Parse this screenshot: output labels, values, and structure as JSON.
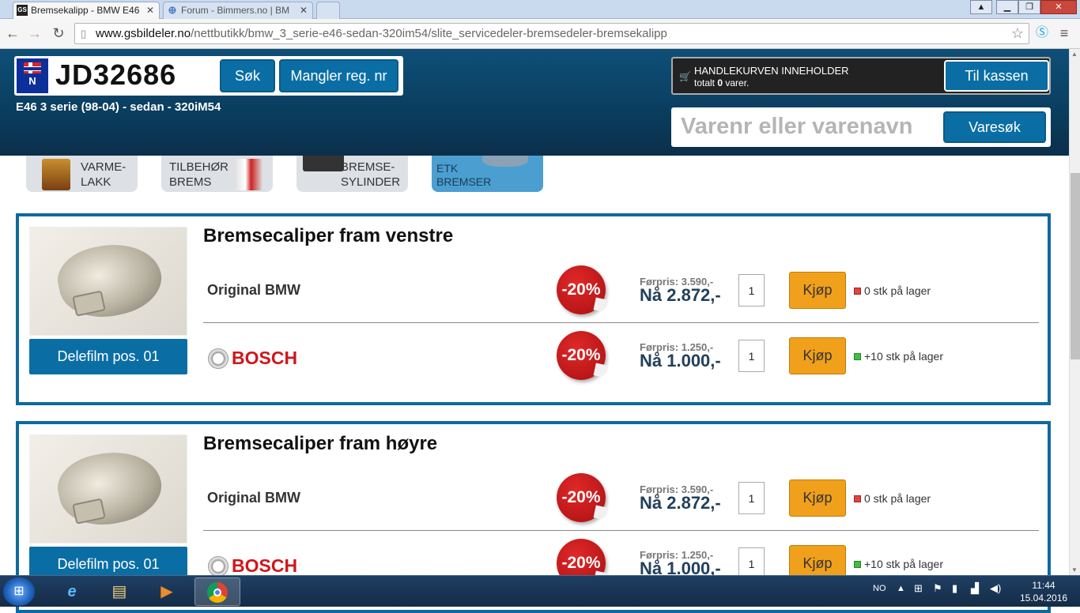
{
  "browser": {
    "tabs": [
      {
        "label": "Bremsekalipp - BMW E46",
        "favicon": "GS",
        "active": true
      },
      {
        "label": "Forum - Bimmers.no | BM",
        "favicon": "globe",
        "active": false
      }
    ],
    "url_prefix": "www.gsbildeler.no",
    "url_path": "/nettbutikk/bmw_3_serie-e46-sedan-320im54/slite_servicedeler-bremsedeler-bremsekalipp"
  },
  "header": {
    "country_code": "N",
    "reg_number": "JD32686",
    "search_button": "Søk",
    "missing_reg_button": "Mangler reg. nr",
    "model": "E46 3 serie (98-04) - sedan - 320iM54",
    "cart": {
      "line1": "HANDLEKURVEN INNEHOLDER",
      "line2_prefix": "totalt ",
      "count": "0",
      "line2_suffix": " varer.",
      "checkout_button": "Til kassen"
    },
    "product_search": {
      "placeholder": "Varenr eller varenavn",
      "button": "Varesøk"
    }
  },
  "categories": [
    {
      "line1": "VARME-",
      "line2": "LAKK"
    },
    {
      "line1": "TILBEHØR",
      "line2": "BREMS"
    },
    {
      "line1": "BREMSE-",
      "line2": "SYLINDER"
    },
    {
      "line1": "ETK",
      "line2": "BREMSER",
      "selected": true
    }
  ],
  "products": [
    {
      "title": "Bremsecaliper fram venstre",
      "delefilm": "Delefilm pos. 01",
      "offers": [
        {
          "brand": "Original BMW",
          "discount": "-20%",
          "forpris": "Førpris: 3.590,-",
          "napris": "Nå 2.872,-",
          "qty": "1",
          "buy": "Kjøp",
          "stock": "0 stk på lager",
          "in_stock": false
        },
        {
          "brand": "BOSCH",
          "discount": "-20%",
          "forpris": "Førpris: 1.250,-",
          "napris": "Nå 1.000,-",
          "qty": "1",
          "buy": "Kjøp",
          "stock": "+10 stk på lager",
          "in_stock": true
        }
      ]
    },
    {
      "title": "Bremsecaliper fram høyre",
      "delefilm": "Delefilm pos. 01",
      "offers": [
        {
          "brand": "Original BMW",
          "discount": "-20%",
          "forpris": "Førpris: 3.590,-",
          "napris": "Nå 2.872,-",
          "qty": "1",
          "buy": "Kjøp",
          "stock": "0 stk på lager",
          "in_stock": false
        },
        {
          "brand": "BOSCH",
          "discount": "-20%",
          "forpris": "Førpris: 1.250,-",
          "napris": "Nå 1.000,-",
          "qty": "1",
          "buy": "Kjøp",
          "stock": "+10 stk på lager",
          "in_stock": true
        }
      ]
    }
  ],
  "taskbar": {
    "language": "NO",
    "time": "11:44",
    "date": "15.04.2016"
  },
  "colors": {
    "header_blue": "#0a3d5e",
    "button_blue": "#0a6ea5",
    "buy_orange": "#f0a01b",
    "discount_red": "#d61f23",
    "bosch_red": "#d0161b"
  }
}
